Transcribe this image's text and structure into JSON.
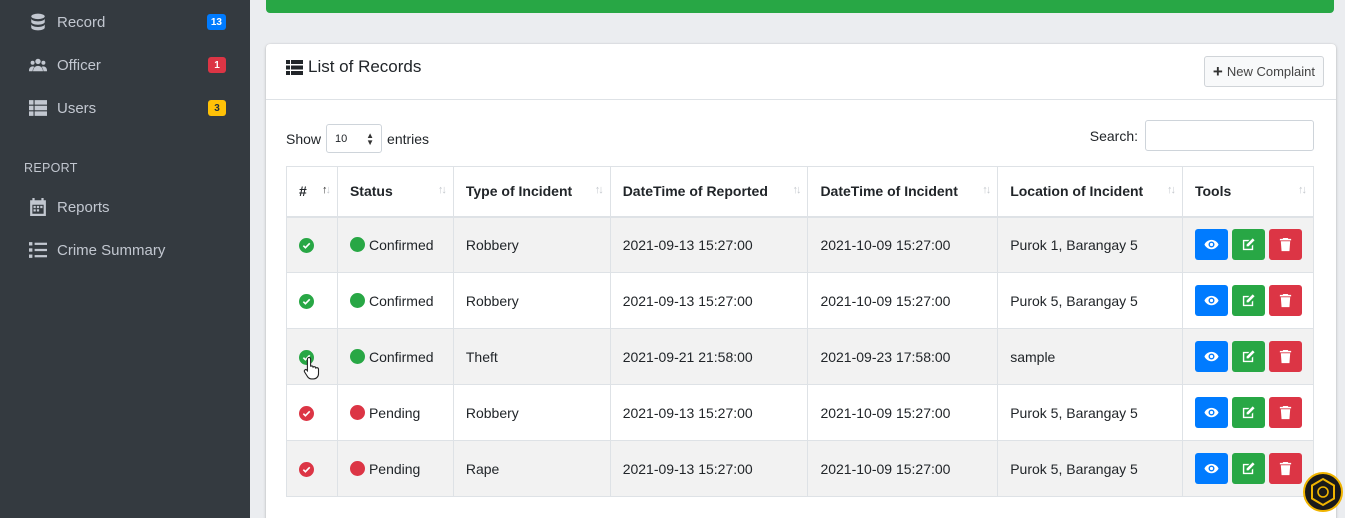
{
  "sidebar": {
    "items": [
      {
        "label": "Record",
        "badge": "13",
        "icon": "database-icon"
      },
      {
        "label": "Officer",
        "badge": "1",
        "icon": "users-group-icon"
      },
      {
        "label": "Users",
        "badge": "3",
        "icon": "table-list-icon"
      }
    ],
    "report_header": "REPORT",
    "report_items": [
      {
        "label": "Reports",
        "icon": "calendar-icon"
      },
      {
        "label": "Crime Summary",
        "icon": "list-icon"
      }
    ]
  },
  "card": {
    "title": "List of Records",
    "new_button": "New Complaint"
  },
  "controls": {
    "show_label": "Show",
    "entries_value": "10",
    "entries_label": "entries",
    "search_label": "Search:",
    "search_value": ""
  },
  "table": {
    "headers": [
      "#",
      "Status",
      "Type of Incident",
      "DateTime of Reported",
      "DateTime of Incident",
      "Location of Incident",
      "Tools"
    ],
    "rows": [
      {
        "status": "Confirmed",
        "type": "Robbery",
        "reported": "2021-09-13 15:27:00",
        "incident": "2021-10-09 15:27:00",
        "location": "Purok 1, Barangay 5"
      },
      {
        "status": "Confirmed",
        "type": "Robbery",
        "reported": "2021-09-13 15:27:00",
        "incident": "2021-10-09 15:27:00",
        "location": "Purok 5, Barangay 5"
      },
      {
        "status": "Confirmed",
        "type": "Theft",
        "reported": "2021-09-21 21:58:00",
        "incident": "2021-09-23 17:58:00",
        "location": "sample"
      },
      {
        "status": "Pending",
        "type": "Robbery",
        "reported": "2021-09-13 15:27:00",
        "incident": "2021-10-09 15:27:00",
        "location": "Purok 5, Barangay 5"
      },
      {
        "status": "Pending",
        "type": "Rape",
        "reported": "2021-09-13 15:27:00",
        "incident": "2021-10-09 15:27:00",
        "location": "Purok 5, Barangay 5"
      }
    ]
  },
  "colors": {
    "sidebar_bg": "#343a40",
    "green": "#28a745",
    "red": "#dc3545",
    "blue": "#007bff",
    "yellow": "#ffc107"
  }
}
